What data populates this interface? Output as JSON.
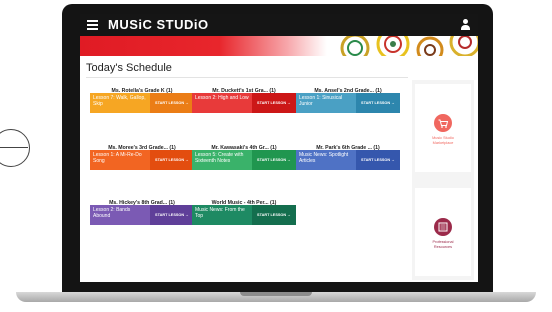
{
  "app": {
    "brand": "MUSiC STUDiO"
  },
  "page": {
    "title": "Today's Schedule"
  },
  "start_label": "START LESSON →",
  "classes": [
    {
      "title": "Ms. Rotella's Grade K (1)",
      "lesson": "Lesson 7: Walk, Gallop, Skip",
      "color": "#f6a623",
      "start_color": "#eb7d16"
    },
    {
      "title": "Mr. Duckett's 1st Gra... (1)",
      "lesson": "Lesson 2: High and Low",
      "color": "#e83a3a",
      "start_color": "#cc1717"
    },
    {
      "title": "Ms. Ansel's 2nd Grade... (1)",
      "lesson": "Lesson 1: Sinusical Junior",
      "color": "#4aa0c4",
      "start_color": "#2d86ad"
    },
    {
      "title": "Ms. Moree's 3rd Grade... (1)",
      "lesson": "Lesson 1: A Mi-Re-Do Song",
      "color": "#f26522",
      "start_color": "#e34d0f"
    },
    {
      "title": "Mr. Kawasaki's 4th Gr... (1)",
      "lesson": "Lesson 5: Create with Sixteenth Notes",
      "color": "#3ab26a",
      "start_color": "#20964f"
    },
    {
      "title": "Mr. Park's 6th Grade ... (1)",
      "lesson": "Music News: Spotlight Articles",
      "color": "#4f72c5",
      "start_color": "#3557ad"
    },
    {
      "title": "Ms. Hickey's 8th Grad... (1)",
      "lesson": "Lesson 2: Bands Abound",
      "color": "#7b5ab4",
      "start_color": "#5f3f99"
    },
    {
      "title": "World Music - 4th Per... (1)",
      "lesson": "Music News: From the Top",
      "color": "#1e8a63",
      "start_color": "#146e4e"
    }
  ],
  "sidebar": [
    {
      "label_line1": "Music Studio",
      "label_line2": "Marketplace",
      "icon": "cart-icon",
      "color": "#f0675f"
    },
    {
      "label_line1": "Professional",
      "label_line2": "Resources",
      "icon": "book-icon",
      "color": "#9b2a4a"
    }
  ]
}
